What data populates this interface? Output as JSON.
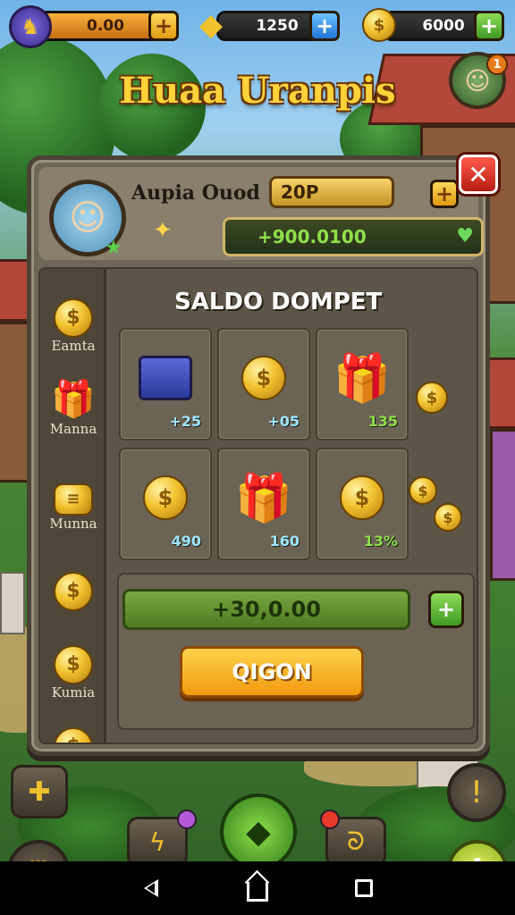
{
  "topbar": {
    "resources": [
      {
        "name": "profile",
        "value": "0.00"
      },
      {
        "name": "gems",
        "value": "1250"
      },
      {
        "name": "coins",
        "value": "6000"
      }
    ]
  },
  "header": {
    "title": "Huaa Uranpis",
    "notification_count": "1"
  },
  "panel": {
    "player_name": "Aupia Ouod",
    "level": "20P",
    "balance": "+900.0100",
    "section_title": "SALDO DOMPET",
    "side_items": [
      {
        "icon": "coin-icon",
        "label": "Eamta"
      },
      {
        "icon": "gift-icon",
        "label": "Manna"
      },
      {
        "icon": "coin-stack-icon",
        "label": "Munna"
      },
      {
        "icon": "coin-icon",
        "label": ""
      },
      {
        "icon": "coin-icon",
        "label": "Kumia"
      }
    ],
    "items": [
      {
        "icon": "chest-icon",
        "value": "+25"
      },
      {
        "icon": "coin-stack-icon",
        "value": "+05"
      },
      {
        "icon": "gift-icon",
        "value": "135"
      },
      {
        "icon": "coin-stack-icon",
        "value": "490"
      },
      {
        "icon": "gift-icon",
        "value": "160"
      },
      {
        "icon": "coin-pile-icon",
        "value": "13%"
      }
    ],
    "amount": "+30,0.00",
    "action_label": "QIGON"
  },
  "colors": {
    "accent_gold": "#f2c12e",
    "close_red": "#d8281a",
    "balance_green": "#8ee04a"
  }
}
